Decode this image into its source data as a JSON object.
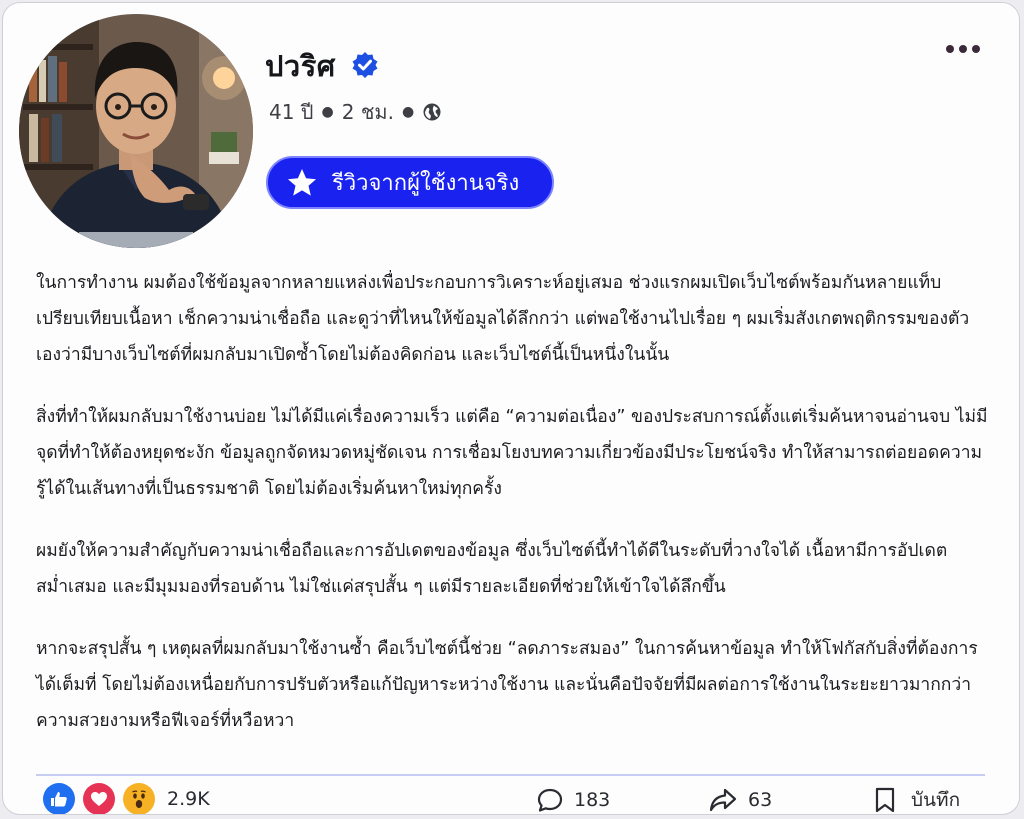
{
  "post": {
    "author_name": "ปวริศ",
    "author_age": "41 ปี",
    "time_ago": "2 ชม.",
    "badge_label": "รีวิวจากผู้ใช้งานจริง",
    "paragraphs": [
      "ในการทำงาน ผมต้องใช้ข้อมูลจากหลายแหล่งเพื่อประกอบการวิเคราะห์อยู่เสมอ ช่วงแรกผมเปิดเว็บไซต์พร้อมกันหลายแท็บ เปรียบเทียบเนื้อหา เช็กความน่าเชื่อถือ และดูว่าที่ไหนให้ข้อมูลได้ลึกกว่า แต่พอใช้งานไปเรื่อย ๆ ผมเริ่มสังเกตพฤติกรรมของตัวเองว่ามีบางเว็บไซต์ที่ผมกลับมาเปิดซ้ำโดยไม่ต้องคิดก่อน และเว็บไซต์นี้เป็นหนึ่งในนั้น",
      "สิ่งที่ทำให้ผมกลับมาใช้งานบ่อย ไม่ได้มีแค่เรื่องความเร็ว แต่คือ “ความต่อเนื่อง” ของประสบการณ์ตั้งแต่เริ่มค้นหาจนอ่านจบ ไม่มีจุดที่ทำให้ต้องหยุดชะงัก ข้อมูลถูกจัดหมวดหมู่ชัดเจน การเชื่อมโยงบทความเกี่ยวข้องมีประโยชน์จริง ทำให้สามารถต่อยอดความรู้ได้ในเส้นทางที่เป็นธรรมชาติ โดยไม่ต้องเริ่มค้นหาใหม่ทุกครั้ง",
      "ผมยังให้ความสำคัญกับความน่าเชื่อถือและการอัปเดตของข้อมูล ซึ่งเว็บไซต์นี้ทำได้ดีในระดับที่วางใจได้ เนื้อหามีการอัปเดตสม่ำเสมอ และมีมุมมองที่รอบด้าน ไม่ใช่แค่สรุปสั้น ๆ แต่มีรายละเอียดที่ช่วยให้เข้าใจได้ลึกขึ้น",
      "หากจะสรุปสั้น ๆ เหตุผลที่ผมกลับมาใช้งานซ้ำ คือเว็บไซต์นี้ช่วย “ลดภาระสมอง” ในการค้นหาข้อมูล ทำให้โฟกัสกับสิ่งที่ต้องการได้เต็มที่ โดยไม่ต้องเหนื่อยกับการปรับตัวหรือแก้ปัญหาระหว่างใช้งาน และนั่นคือปัจจัยที่มีผลต่อการใช้งานในระยะยาวมากกว่าความสวยงามหรือฟีเจอร์ที่หวือหวา"
    ]
  },
  "footer": {
    "reaction_count": "2.9K",
    "comment_count": "183",
    "share_count": "63",
    "save_label": "บันทึก"
  },
  "icons": {
    "verified": "verified-check-icon",
    "globe": "globe-icon",
    "star": "star-icon",
    "more": "more-horizontal-icon",
    "like": "thumbs-up-icon",
    "love": "heart-icon",
    "wow": "wow-face-icon",
    "comment": "comment-bubble-icon",
    "share": "share-arrow-icon",
    "bookmark": "bookmark-icon"
  },
  "colors": {
    "badge_background": "#1a22f0",
    "verified_blue": "#1d4fe3",
    "like_blue": "#1f6ff0",
    "love_red": "#e63355",
    "wow_yellow": "#f7b125"
  }
}
